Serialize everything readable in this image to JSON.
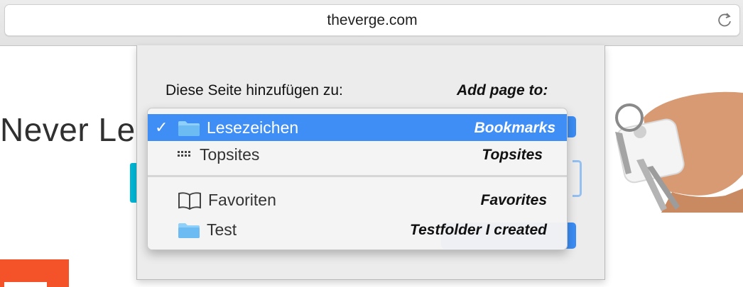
{
  "browser": {
    "url": "theverge.com"
  },
  "page": {
    "headline": "Never Le"
  },
  "popover": {
    "label": "Diese Seite hinzufügen zu:",
    "annotation": "Add page to:"
  },
  "menu": {
    "items": [
      {
        "label": "Lesezeichen",
        "annotation": "Bookmarks",
        "icon": "folder-icon",
        "selected": true
      },
      {
        "label": "Topsites",
        "annotation": "Topsites",
        "icon": "grid-icon",
        "selected": false
      },
      {
        "label": "Favoriten",
        "annotation": "Favorites",
        "icon": "book-icon",
        "selected": false
      },
      {
        "label": "Test",
        "annotation": "Testfolder I created",
        "icon": "folder-icon",
        "selected": false
      }
    ],
    "checkmark": "✓"
  },
  "colors": {
    "selection": "#3e8ef6",
    "folder": "#6fbdf2"
  }
}
